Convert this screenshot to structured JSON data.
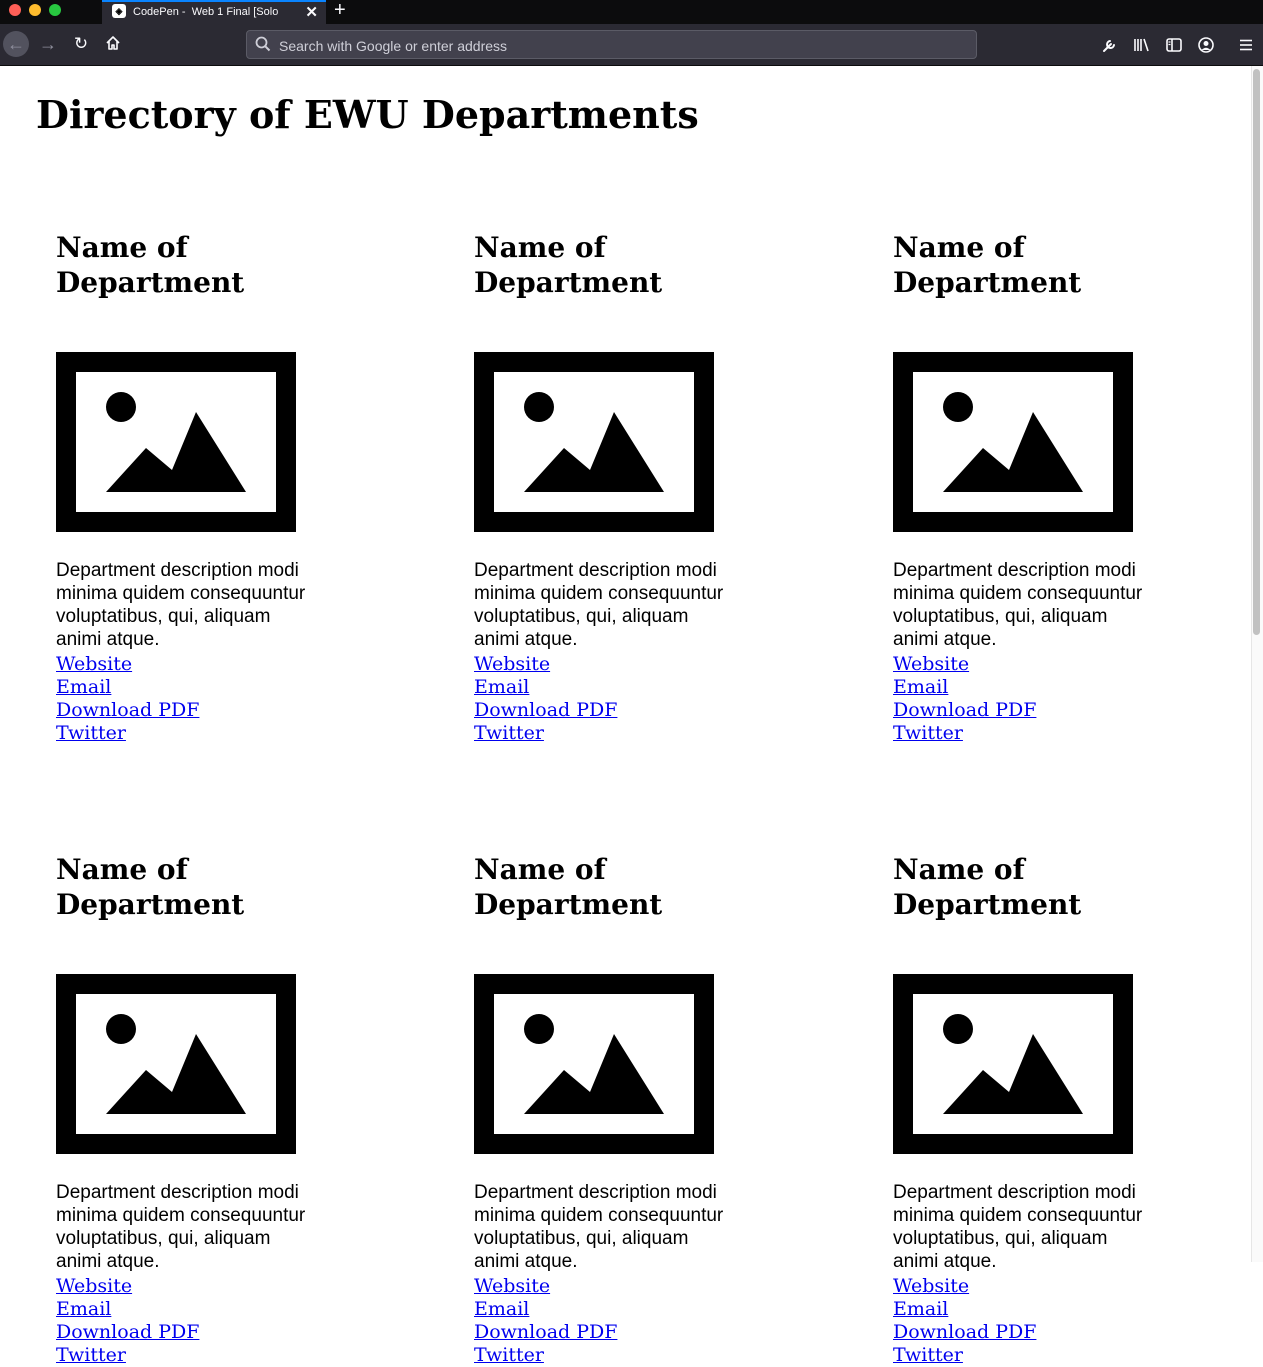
{
  "browser": {
    "tab_title": "CodePen -  Web 1 Final [Solo",
    "tab_close": "✕",
    "new_tab": "+",
    "url_placeholder": "Search with Google or enter address"
  },
  "page": {
    "title": "Directory of EWU Departments"
  },
  "departments": [
    {
      "name": "Name of Department",
      "description": "Department description modi minima quidem consequuntur voluptatibus, qui, aliquam animi atque.",
      "links": [
        "Website",
        "Email",
        "Download PDF",
        "Twitter"
      ]
    },
    {
      "name": "Name of Department",
      "description": "Department description modi minima quidem consequuntur voluptatibus, qui, aliquam animi atque.",
      "links": [
        "Website",
        "Email",
        "Download PDF",
        "Twitter"
      ]
    },
    {
      "name": "Name of Department",
      "description": "Department description modi minima quidem consequuntur voluptatibus, qui, aliquam animi atque.",
      "links": [
        "Website",
        "Email",
        "Download PDF",
        "Twitter"
      ]
    },
    {
      "name": "Name of Department",
      "description": "Department description modi minima quidem consequuntur voluptatibus, qui, aliquam animi atque.",
      "links": [
        "Website",
        "Email",
        "Download PDF",
        "Twitter"
      ]
    },
    {
      "name": "Name of Department",
      "description": "Department description modi minima quidem consequuntur voluptatibus, qui, aliquam animi atque.",
      "links": [
        "Website",
        "Email",
        "Download PDF",
        "Twitter"
      ]
    },
    {
      "name": "Name of Department",
      "description": "Department description modi minima quidem consequuntur voluptatibus, qui, aliquam animi atque.",
      "links": [
        "Website",
        "Email",
        "Download PDF",
        "Twitter"
      ]
    }
  ],
  "colors": {
    "link": "#0000ee",
    "chrome_dark": "#0c0c0d",
    "toolbar": "#2b2a33"
  }
}
